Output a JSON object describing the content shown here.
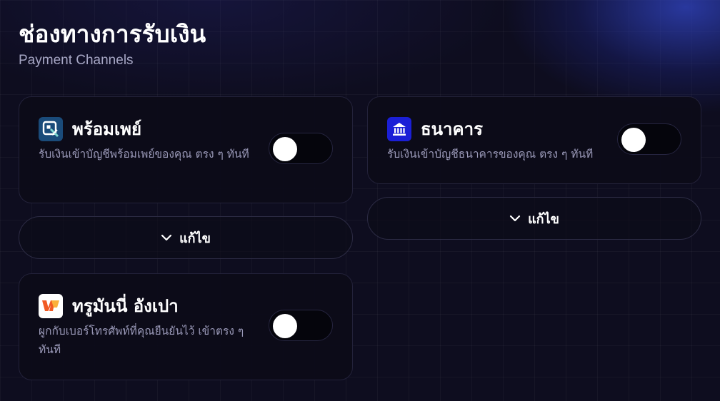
{
  "header": {
    "title": "ช่องทางการรับเงิน",
    "subtitle": "Payment Channels"
  },
  "channels": {
    "promptpay": {
      "title": "พร้อมเพย์",
      "description": "รับเงินเข้าบัญชีพร้อมเพย์ของคุณ ตรง ๆ ทันที",
      "icon": "promptpay-logo-icon",
      "enabled": false
    },
    "bank": {
      "title": "ธนาคาร",
      "description": "รับเงินเข้าบัญชีธนาคารของคุณ ตรง ๆ ทันที",
      "icon": "bank-icon",
      "enabled": false
    },
    "truemoney": {
      "title": "ทรูมันนี่ อังเปา",
      "description": "ผูกกับเบอร์โทรศัพท์ที่คุณยืนยันไว้ เข้าตรง ๆ ทันที",
      "icon": "truemoney-logo-icon",
      "enabled": false
    }
  },
  "edit_buttons": {
    "left_label": "แก้ไข",
    "right_label": "แก้ไข",
    "icon": "chevron-down-icon"
  },
  "colors": {
    "background": "#0e0d1f",
    "card": "#0c0b18",
    "promptpay_logo": "#1a4b7a",
    "bank_logo": "#1b1fd6",
    "truemoney_logo": "#ffffff"
  }
}
